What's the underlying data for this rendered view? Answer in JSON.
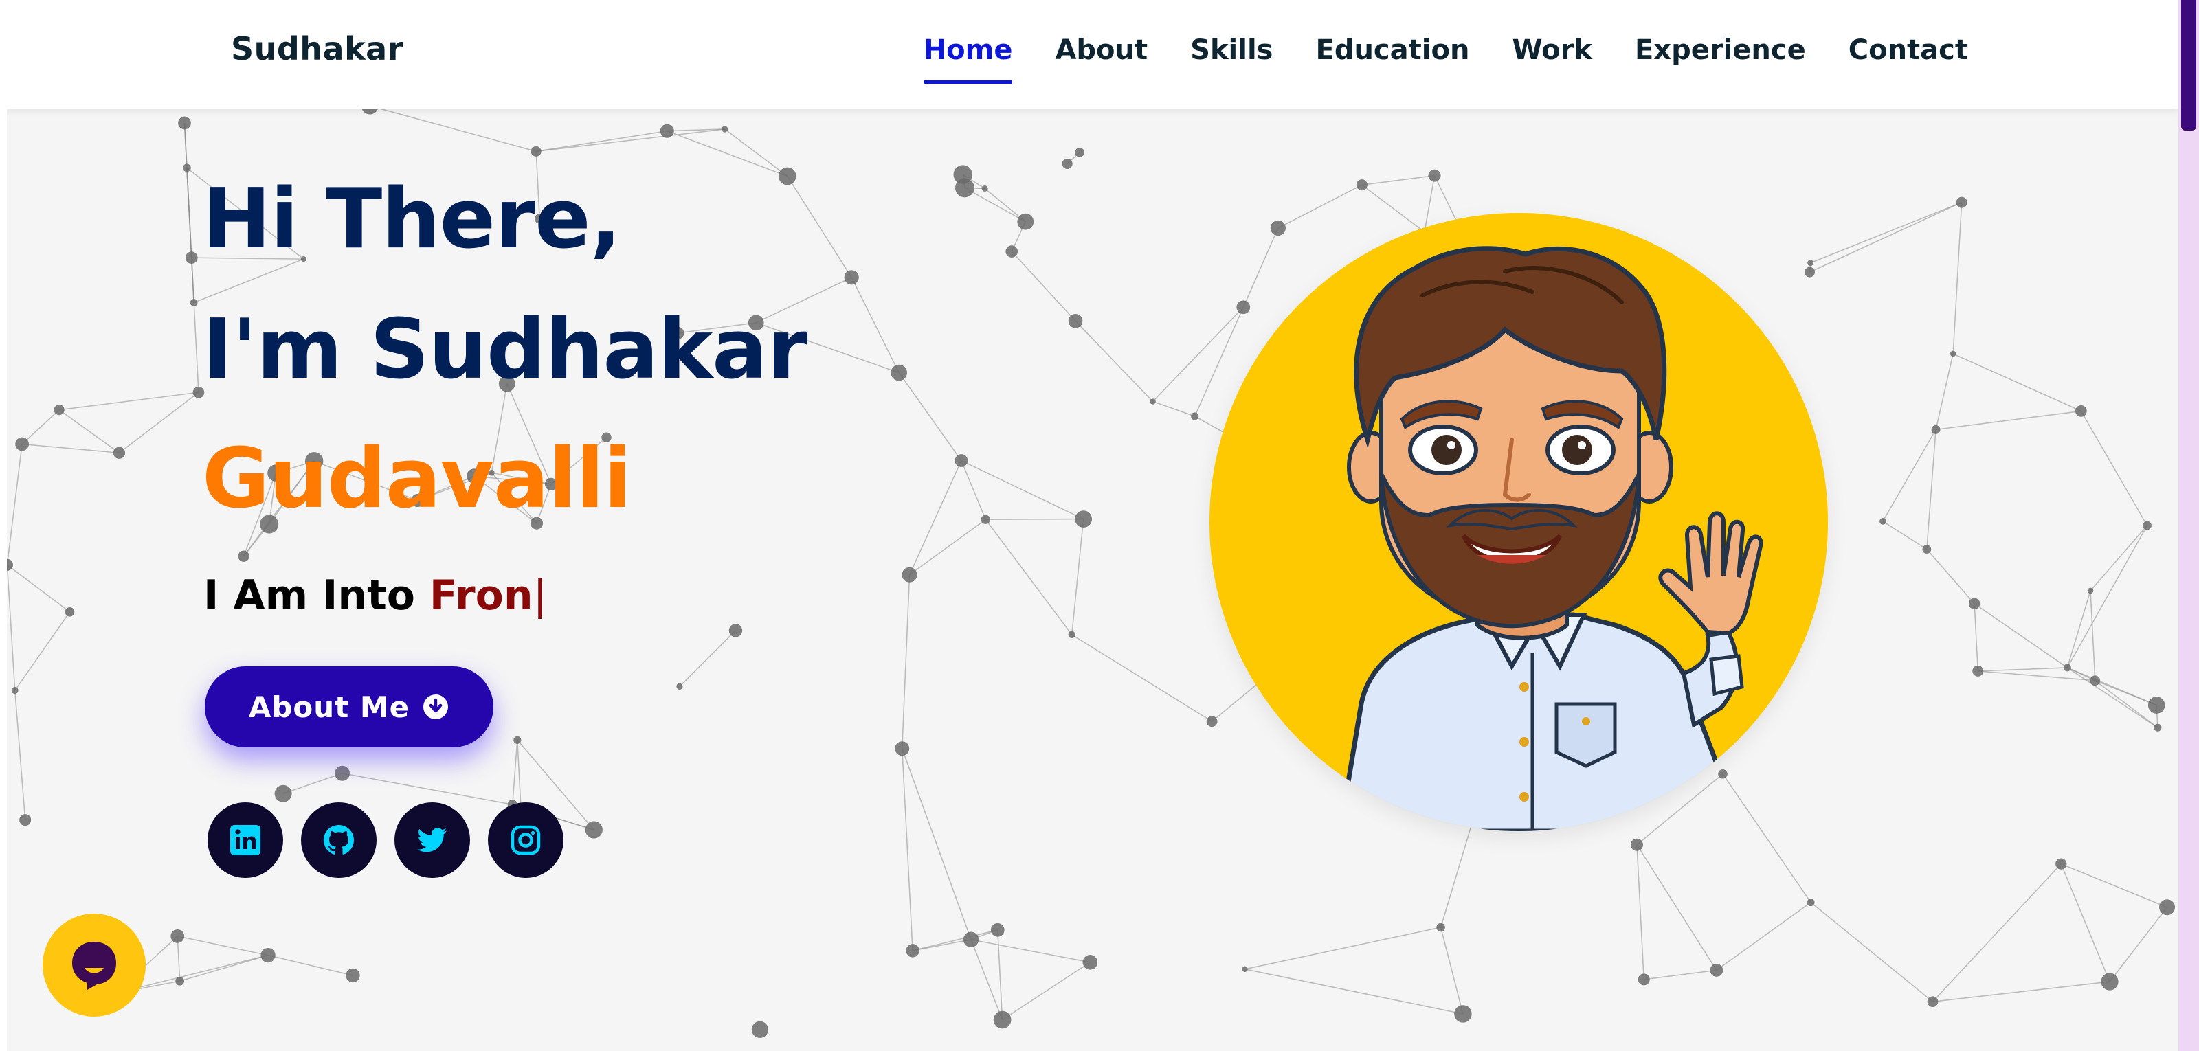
{
  "header": {
    "brand": "Sudhakar",
    "nav": [
      {
        "label": "Home",
        "active": true
      },
      {
        "label": "About",
        "active": false
      },
      {
        "label": "Skills",
        "active": false
      },
      {
        "label": "Education",
        "active": false
      },
      {
        "label": "Work",
        "active": false
      },
      {
        "label": "Experience",
        "active": false
      },
      {
        "label": "Contact",
        "active": false
      }
    ]
  },
  "hero": {
    "greeting": "Hi There,",
    "intro": "I'm Sudhakar",
    "last_name": "Gudavalli",
    "typing_prefix": "I Am Into ",
    "typing_word": "Fron",
    "cursor": "|",
    "cta_label": "About Me",
    "cta_icon": "arrow-circle-down-icon"
  },
  "socials": [
    {
      "name": "linkedin-icon"
    },
    {
      "name": "github-icon"
    },
    {
      "name": "twitter-icon"
    },
    {
      "name": "instagram-icon"
    }
  ],
  "colors": {
    "nav_active": "#0f17d6",
    "heading": "#002057",
    "accent_orange": "#ff7a00",
    "typing_word": "#8a0a0a",
    "cta_bg": "#2506ad",
    "social_bg": "#0e0a2f",
    "social_icon": "#00d4ff",
    "avatar_bg": "#ffc900",
    "chat_bg": "#ffc50f"
  }
}
